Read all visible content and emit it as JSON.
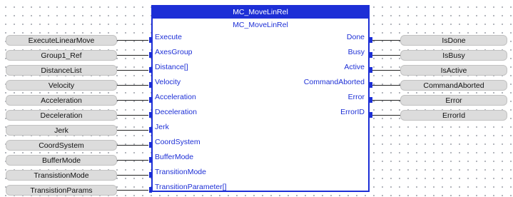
{
  "block": {
    "instance_name": "MC_MoveLinRel",
    "type_name": "MC_MoveLinRel"
  },
  "inputs": [
    {
      "port": "Execute",
      "variable": "ExecuteLinearMove"
    },
    {
      "port": "AxesGroup",
      "variable": "Group1_Ref"
    },
    {
      "port": "Distance[]",
      "variable": "DistanceList"
    },
    {
      "port": "Velocity",
      "variable": "Velocity"
    },
    {
      "port": "Acceleration",
      "variable": "Acceleration"
    },
    {
      "port": "Deceleration",
      "variable": "Deceleration"
    },
    {
      "port": "Jerk",
      "variable": "Jerk"
    },
    {
      "port": "CoordSystem",
      "variable": "CoordSystem"
    },
    {
      "port": "BufferMode",
      "variable": "BufferMode"
    },
    {
      "port": "TransitionMode",
      "variable": "TransistionMode"
    },
    {
      "port": "TransitionParameter[]",
      "variable": "TransistionParams"
    }
  ],
  "outputs": [
    {
      "port": "Done",
      "variable": "IsDone"
    },
    {
      "port": "Busy",
      "variable": "IsBusy"
    },
    {
      "port": "Active",
      "variable": "IsActive"
    },
    {
      "port": "CommandAborted",
      "variable": "CommandAborted"
    },
    {
      "port": "Error",
      "variable": "Error"
    },
    {
      "port": "ErrorID",
      "variable": "ErrorId"
    }
  ],
  "colors": {
    "block_blue": "#1d2fd6",
    "variable_box_fill": "#dcdcdc",
    "wire": "#222222"
  }
}
